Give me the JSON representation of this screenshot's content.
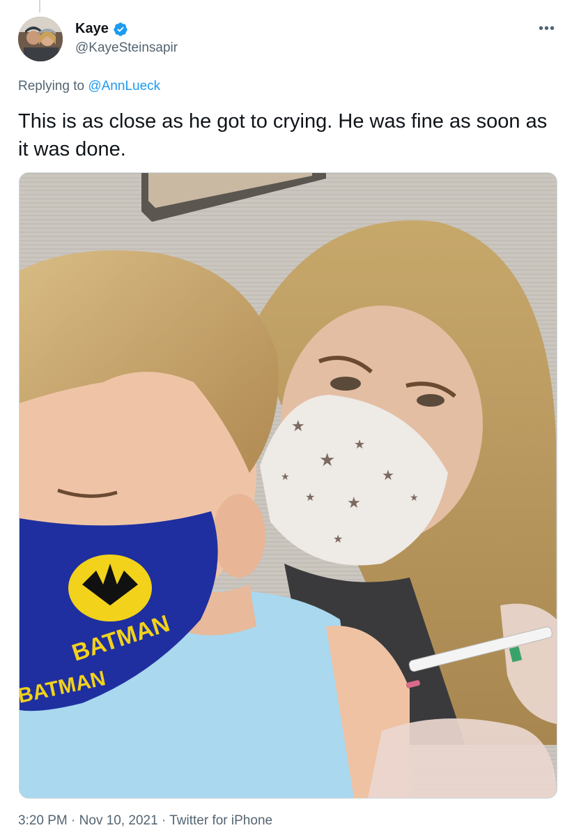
{
  "author": {
    "display_name": "Kaye",
    "handle": "@KayeSteinsapir",
    "verified": true
  },
  "reply": {
    "prefix": "Replying to",
    "target": "@AnnLueck"
  },
  "tweet": {
    "text": "This is as close as he got to crying. He was fine as soon as it was done."
  },
  "meta": {
    "time": "3:20 PM",
    "separator": "·",
    "date": "Nov 10, 2021",
    "source": "Twitter for iPhone"
  },
  "icons": {
    "verified": "verified-badge-icon",
    "more": "more-options-icon"
  },
  "colors": {
    "link": "#1d9bf0",
    "secondary_text": "#536471",
    "verified": "#1d9bf0"
  }
}
